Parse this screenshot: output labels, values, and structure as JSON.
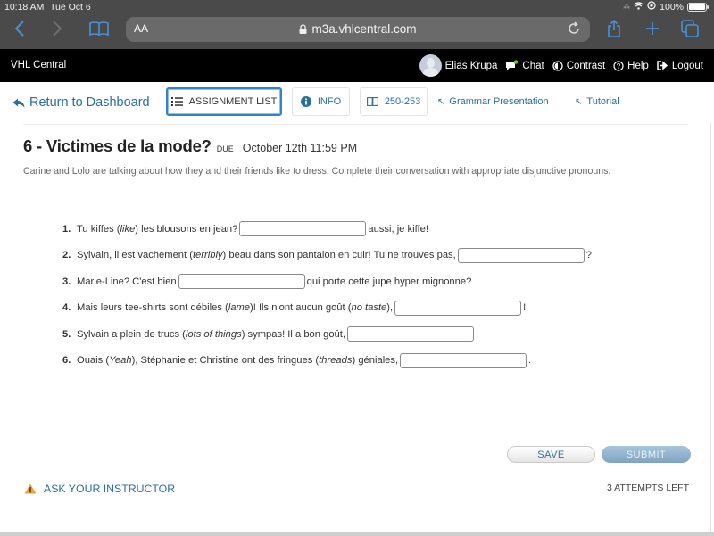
{
  "status_bar": {
    "time": "10:18 AM",
    "date": "Tue Oct 6",
    "battery": "100%"
  },
  "browser": {
    "text_size_label": "AA",
    "url": "m3a.vhlcentral.com",
    "icons": [
      "back-icon",
      "forward-icon",
      "bookmarks-icon",
      "lock-icon",
      "reload-icon",
      "share-icon",
      "new-tab-icon",
      "tabs-icon"
    ]
  },
  "header": {
    "brand": "VHL Central",
    "user_name": "Elias Krupa",
    "chat": "Chat",
    "contrast": "Contrast",
    "help": "Help",
    "logout": "Logout",
    "chat_badge_color": "#5cc33a"
  },
  "toolbar": {
    "return": "Return to Dashboard",
    "assignment_list": "ASSIGNMENT LIST",
    "info": "INFO",
    "pages": "250-253",
    "grammar": "Grammar Presentation",
    "tutorial": "Tutorial",
    "accent_color": "#2a6f9b"
  },
  "activity": {
    "title": "6 - Victimes de la mode?",
    "due_label": "DUE",
    "due_date": "October 12th 11:59 PM",
    "instructions": "Carine and Lolo are talking about how they and their friends like to dress. Complete their conversation with appropriate disjunctive pronouns.",
    "questions": [
      {
        "num": "1.",
        "before": "Tu kiffes (",
        "gloss": "like",
        "mid": ") les blousons en jean?",
        "after": "aussi, je kiffe!",
        "answer": ""
      },
      {
        "num": "2.",
        "before": "Sylvain, il est vachement (",
        "gloss": "terribly",
        "mid": ") beau dans son pantalon en cuir! Tu ne trouves pas,",
        "after": "?",
        "answer": ""
      },
      {
        "num": "3.",
        "before": "Marie-Line? C'est bien",
        "gloss": "",
        "mid": "",
        "after": "qui porte cette jupe hyper mignonne?",
        "answer": ""
      },
      {
        "num": "4.",
        "before": "Mais leurs tee-shirts sont débiles (",
        "gloss": "lame",
        "mid": ")! Ils n'ont aucun goût (",
        "gloss2": "no taste",
        "mid2": "),",
        "after": "!",
        "answer": ""
      },
      {
        "num": "5.",
        "before": "Sylvain a plein de trucs (",
        "gloss": "lots of things",
        "mid": ") sympas! Il a bon goût,",
        "after": ".",
        "answer": ""
      },
      {
        "num": "6.",
        "before": "Ouais (",
        "gloss": "Yeah",
        "mid": "), Stéphanie et Christine ont des fringues (",
        "gloss2": "threads",
        "mid2": ") géniales,",
        "after": ".",
        "answer": ""
      }
    ]
  },
  "actions": {
    "save": "SAVE",
    "submit": "SUBMIT",
    "attempts": "3 ATTEMPTS LEFT",
    "ask_instructor": "ASK YOUR INSTRUCTOR"
  }
}
